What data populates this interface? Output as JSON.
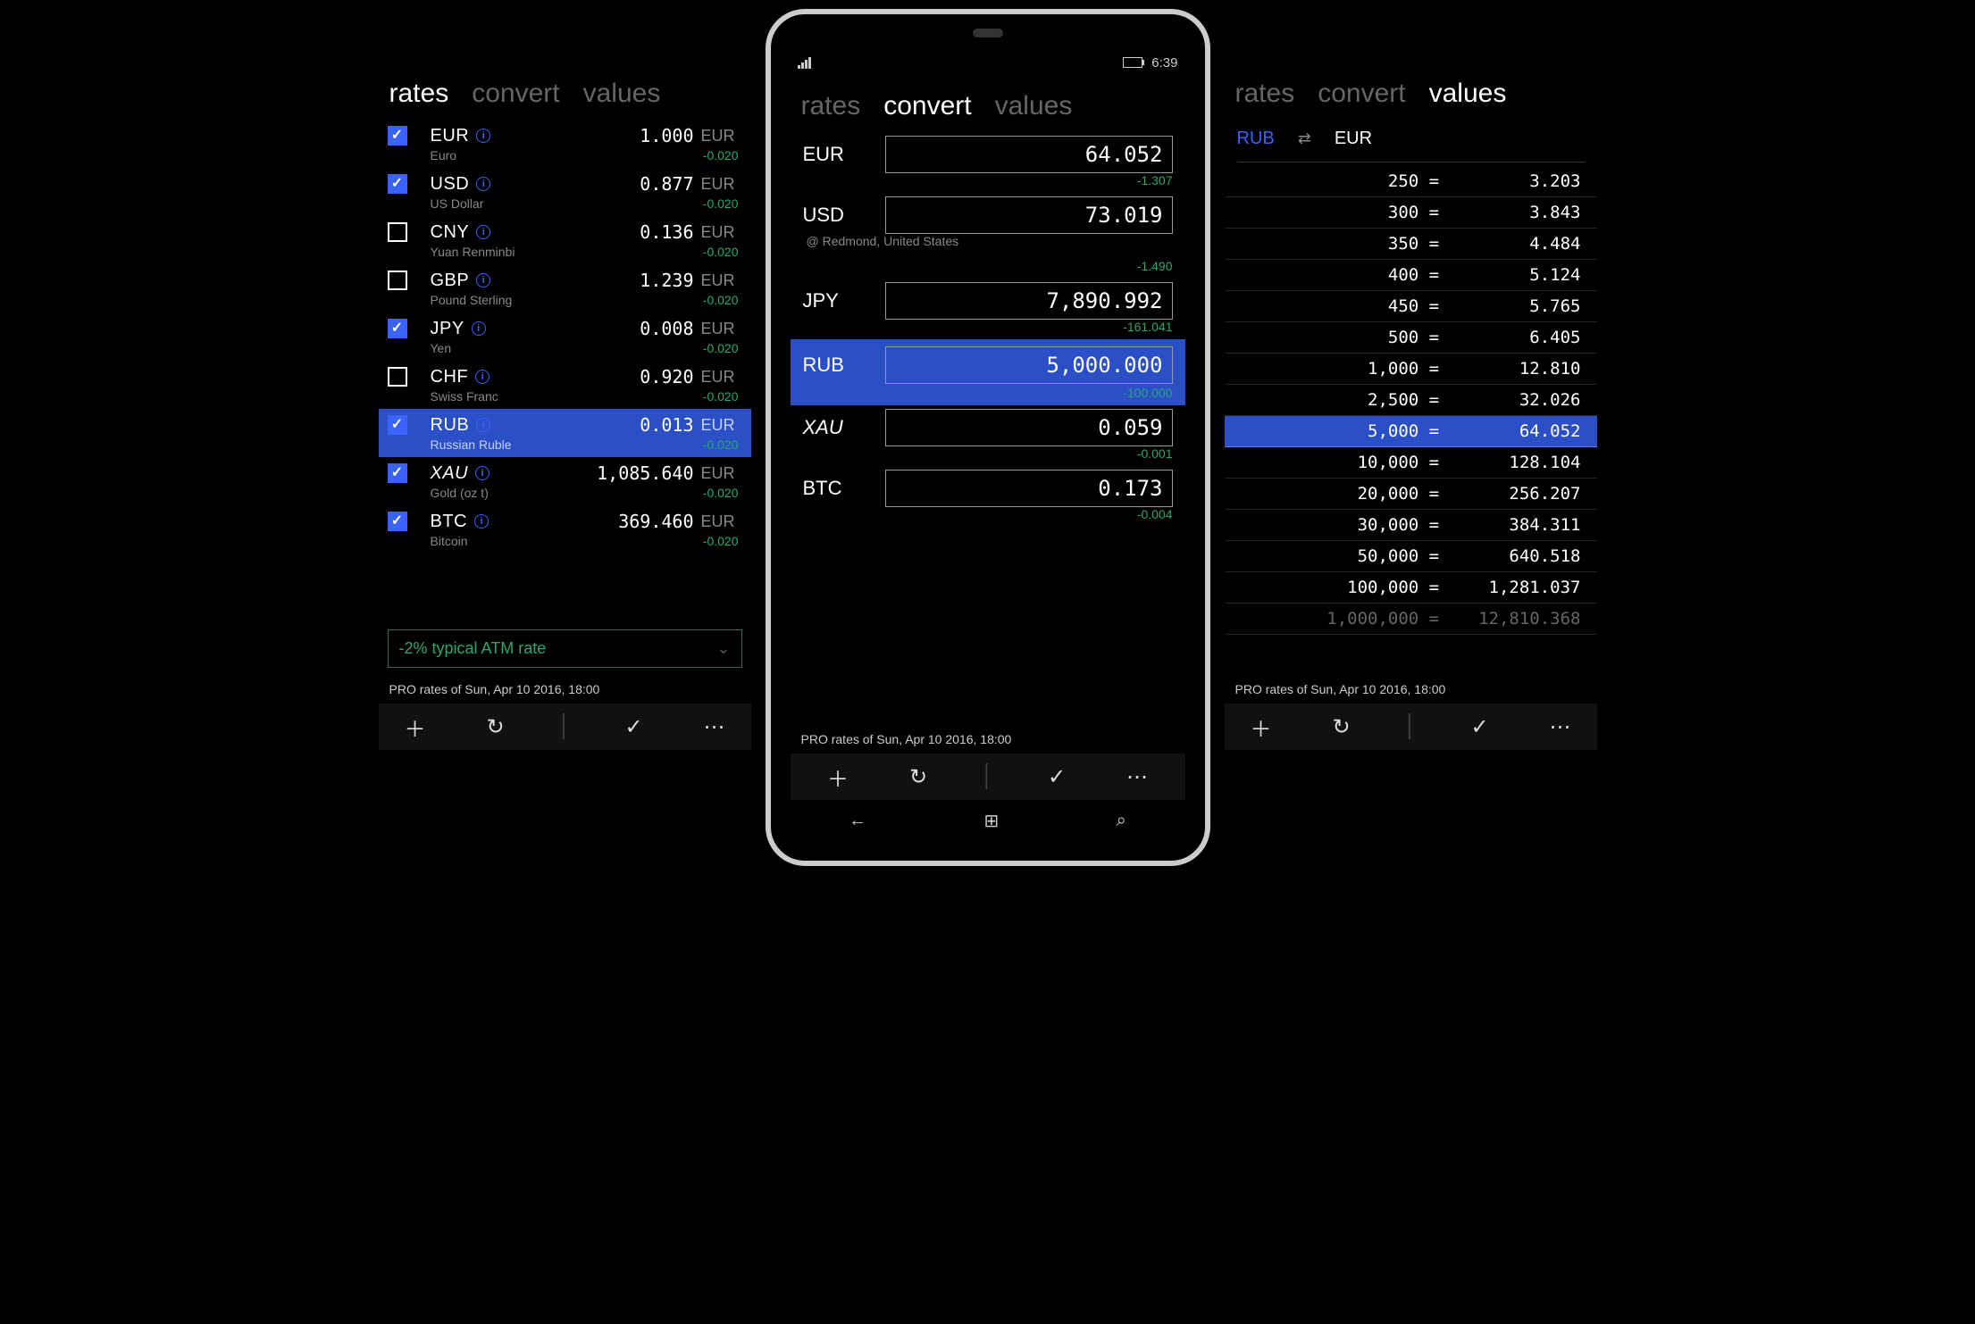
{
  "tabs": {
    "rates": "rates",
    "convert": "convert",
    "values": "values"
  },
  "status": {
    "time": "6:39"
  },
  "footer": "PRO rates of  Sun, Apr 10 2016, 18:00",
  "atm_select": "-2% typical ATM rate",
  "rates": {
    "items": [
      {
        "code": "EUR",
        "name": "Euro",
        "rate": "1.000",
        "unit": "EUR",
        "delta": "-0.020",
        "checked": true,
        "italic": false,
        "highlight": false
      },
      {
        "code": "USD",
        "name": "US Dollar",
        "rate": "0.877",
        "unit": "EUR",
        "delta": "-0.020",
        "checked": true,
        "italic": false,
        "highlight": false
      },
      {
        "code": "CNY",
        "name": "Yuan Renminbi",
        "rate": "0.136",
        "unit": "EUR",
        "delta": "-0.020",
        "checked": false,
        "italic": false,
        "highlight": false
      },
      {
        "code": "GBP",
        "name": "Pound Sterling",
        "rate": "1.239",
        "unit": "EUR",
        "delta": "-0.020",
        "checked": false,
        "italic": false,
        "highlight": false
      },
      {
        "code": "JPY",
        "name": "Yen",
        "rate": "0.008",
        "unit": "EUR",
        "delta": "-0.020",
        "checked": true,
        "italic": false,
        "highlight": false
      },
      {
        "code": "CHF",
        "name": "Swiss Franc",
        "rate": "0.920",
        "unit": "EUR",
        "delta": "-0.020",
        "checked": false,
        "italic": false,
        "highlight": false
      },
      {
        "code": "RUB",
        "name": "Russian Ruble",
        "rate": "0.013",
        "unit": "EUR",
        "delta": "-0.020",
        "checked": true,
        "italic": false,
        "highlight": true
      },
      {
        "code": "XAU",
        "name": "Gold (oz t)",
        "rate": "1,085.640",
        "unit": "EUR",
        "delta": "-0.020",
        "checked": true,
        "italic": true,
        "highlight": false
      },
      {
        "code": "BTC",
        "name": "Bitcoin",
        "rate": "369.460",
        "unit": "EUR",
        "delta": "-0.020",
        "checked": true,
        "italic": false,
        "highlight": false
      }
    ]
  },
  "convert": {
    "location": "@ Redmond, United States",
    "items": [
      {
        "code": "EUR",
        "value": "64.052",
        "delta": "-1.307",
        "italic": false,
        "highlight": false
      },
      {
        "code": "USD",
        "value": "73.019",
        "delta": "-1.490",
        "italic": false,
        "highlight": false,
        "location": true
      },
      {
        "code": "JPY",
        "value": "7,890.992",
        "delta": "-161.041",
        "italic": false,
        "highlight": false
      },
      {
        "code": "RUB",
        "value": "5,000.000",
        "delta": "-100.000",
        "italic": false,
        "highlight": true
      },
      {
        "code": "XAU",
        "value": "0.059",
        "delta": "-0.001",
        "italic": true,
        "highlight": false
      },
      {
        "code": "BTC",
        "value": "0.173",
        "delta": "-0.004",
        "italic": false,
        "highlight": false
      }
    ]
  },
  "values": {
    "from": "RUB",
    "to": "EUR",
    "rows": [
      {
        "lhs": "250 =",
        "rhs": "3.203",
        "highlight": false
      },
      {
        "lhs": "300 =",
        "rhs": "3.843",
        "highlight": false
      },
      {
        "lhs": "350 =",
        "rhs": "4.484",
        "highlight": false
      },
      {
        "lhs": "400 =",
        "rhs": "5.124",
        "highlight": false
      },
      {
        "lhs": "450 =",
        "rhs": "5.765",
        "highlight": false
      },
      {
        "lhs": "500 =",
        "rhs": "6.405",
        "highlight": false
      },
      {
        "lhs": "1,000 =",
        "rhs": "12.810",
        "highlight": false
      },
      {
        "lhs": "2,500 =",
        "rhs": "32.026",
        "highlight": false
      },
      {
        "lhs": "5,000 =",
        "rhs": "64.052",
        "highlight": true
      },
      {
        "lhs": "10,000 =",
        "rhs": "128.104",
        "highlight": false
      },
      {
        "lhs": "20,000 =",
        "rhs": "256.207",
        "highlight": false
      },
      {
        "lhs": "30,000 =",
        "rhs": "384.311",
        "highlight": false
      },
      {
        "lhs": "50,000 =",
        "rhs": "640.518",
        "highlight": false
      },
      {
        "lhs": "100,000 =",
        "rhs": "1,281.037",
        "highlight": false
      },
      {
        "lhs": "1,000,000 =",
        "rhs": "12,810.368",
        "highlight": false,
        "faded": true
      }
    ]
  }
}
